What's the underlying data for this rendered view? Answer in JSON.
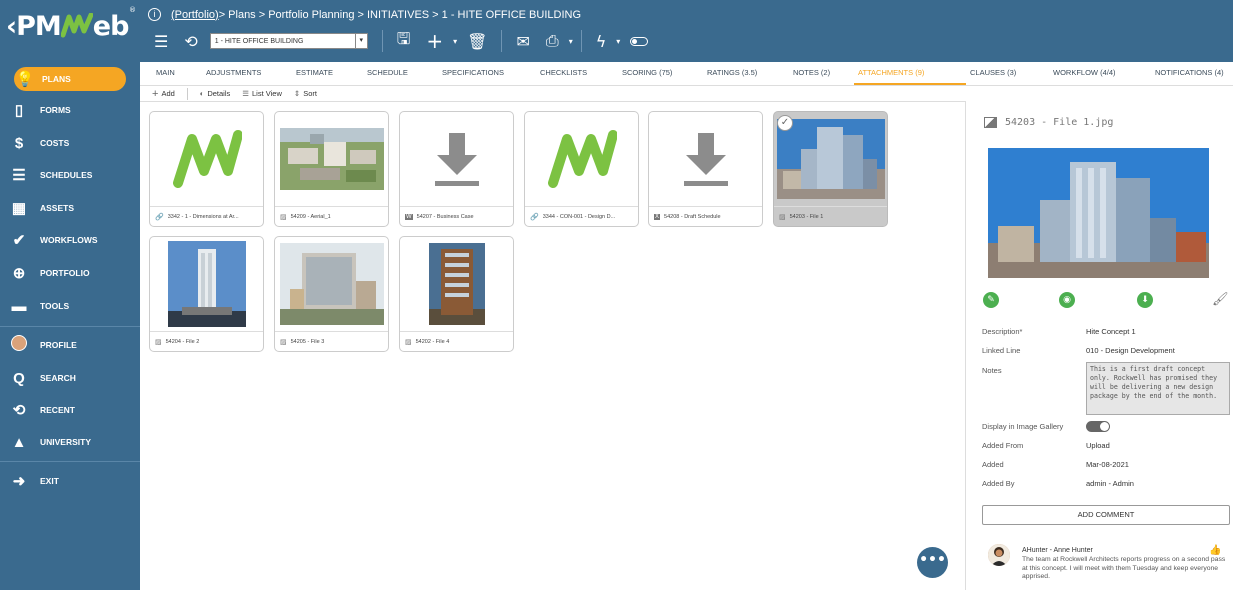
{
  "app": {
    "logo_text": "‹PMWeb",
    "reg": "®"
  },
  "breadcrumb": {
    "portfolio": "(Portfolio)",
    "rest": " > Plans > Portfolio Planning > INITIATIVES > 1 - HITE OFFICE BUILDING"
  },
  "toolbar": {
    "project_select": "1 - HITE OFFICE BUILDING"
  },
  "sidebar": {
    "items": [
      {
        "label": "PLANS",
        "icon": "lightbulb-icon"
      },
      {
        "label": "FORMS",
        "icon": "document-icon"
      },
      {
        "label": "COSTS",
        "icon": "dollar-icon"
      },
      {
        "label": "SCHEDULES",
        "icon": "schedule-bars-icon"
      },
      {
        "label": "ASSETS",
        "icon": "building-icon"
      },
      {
        "label": "WORKFLOWS",
        "icon": "check-icon"
      },
      {
        "label": "PORTFOLIO",
        "icon": "globe-icon"
      },
      {
        "label": "TOOLS",
        "icon": "briefcase-icon"
      },
      {
        "label": "PROFILE",
        "icon": "avatar-icon"
      },
      {
        "label": "SEARCH",
        "icon": "search-icon"
      },
      {
        "label": "RECENT",
        "icon": "history-icon"
      },
      {
        "label": "UNIVERSITY",
        "icon": "graduation-cap-icon"
      },
      {
        "label": "EXIT",
        "icon": "exit-icon"
      }
    ]
  },
  "tabs": [
    {
      "label": "MAIN"
    },
    {
      "label": "ADJUSTMENTS"
    },
    {
      "label": "ESTIMATE"
    },
    {
      "label": "SCHEDULE"
    },
    {
      "label": "SPECIFICATIONS"
    },
    {
      "label": "CHECKLISTS"
    },
    {
      "label": "SCORING (75)"
    },
    {
      "label": "RATINGS (3.5)"
    },
    {
      "label": "NOTES (2)"
    },
    {
      "label": "ATTACHMENTS (9)"
    },
    {
      "label": "CLAUSES (3)"
    },
    {
      "label": "WORKFLOW (4/4)"
    },
    {
      "label": "NOTIFICATIONS (4)"
    }
  ],
  "actions": {
    "add": "Add",
    "details": "Details",
    "list_view": "List View",
    "sort": "Sort"
  },
  "attachments": [
    {
      "caption": "3342 - 1 - Dimensions at Ar...",
      "type": "link"
    },
    {
      "caption": "54209 - Aerial_1",
      "type": "image"
    },
    {
      "caption": "54207 - Business Case",
      "type": "word"
    },
    {
      "caption": "3344 - CON-001 - Design D...",
      "type": "link"
    },
    {
      "caption": "54208 - Draft Schedule",
      "type": "excel"
    },
    {
      "caption": "54203 - File 1",
      "type": "image"
    },
    {
      "caption": "54204 - File 2",
      "type": "image"
    },
    {
      "caption": "54205 - File 3",
      "type": "image"
    },
    {
      "caption": "54202 - File 4",
      "type": "image"
    }
  ],
  "detail": {
    "title": "54203 - File 1.jpg",
    "fields": {
      "description_label": "Description*",
      "description": "Hite Concept 1",
      "linked_line_label": "Linked Line",
      "linked_line": "010 - Design Development",
      "notes_label": "Notes",
      "notes": "This is a first draft concept only. Rockwell has promised they will be delivering a new design package by the end of the month.",
      "gallery_label": "Display in Image Gallery",
      "added_from_label": "Added From",
      "added_from": "Upload",
      "added_label": "Added",
      "added": "Mar-08-2021",
      "added_by_label": "Added By",
      "added_by": "admin - Admin"
    },
    "add_comment": "ADD COMMENT",
    "comment": {
      "author": "AHunter - Anne Hunter",
      "text": "The team at Rockwell Architects reports progress on a second pass at this concept. I will meet with them Tuesday and keep everyone apprised."
    }
  },
  "colors": {
    "accent": "#f5a623",
    "brand": "#3a6a8e",
    "action_green": "#4caf50"
  }
}
